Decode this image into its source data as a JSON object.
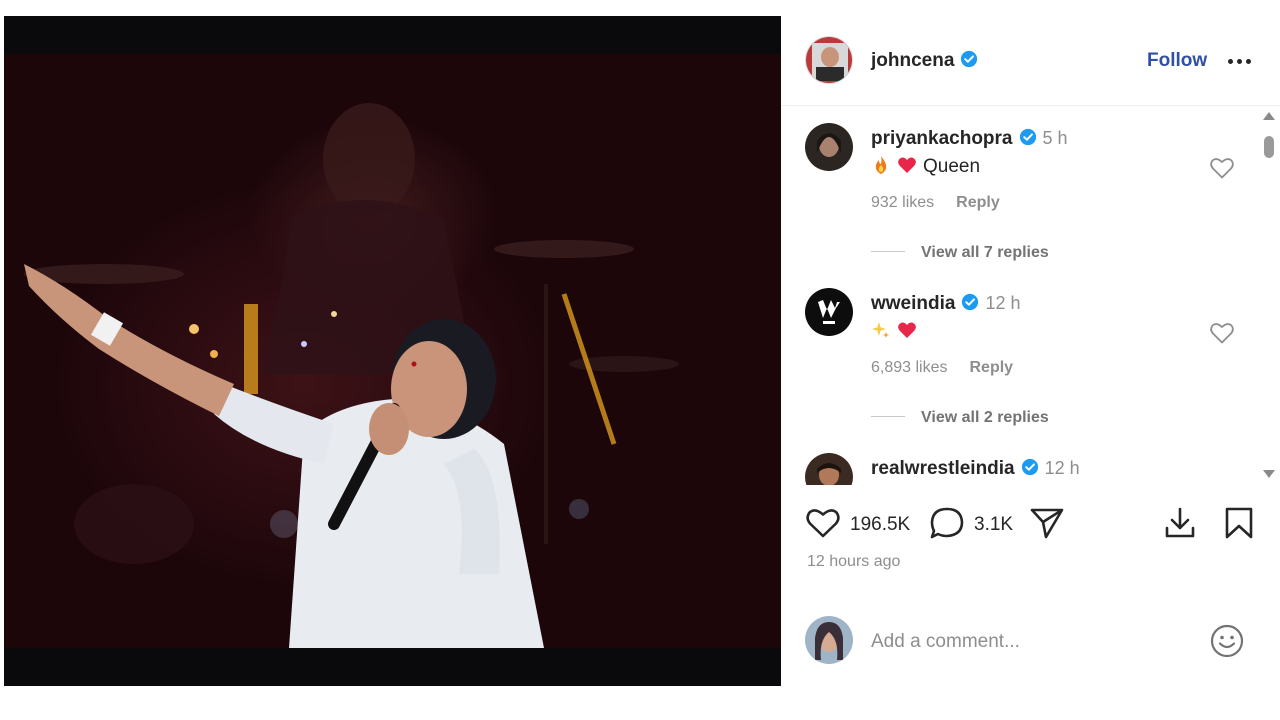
{
  "post": {
    "author": "johncena",
    "follow_label": "Follow",
    "likes_count": "196.5K",
    "comments_count": "3.1K",
    "time_ago": "12 hours ago"
  },
  "comments": [
    {
      "user": "priyankachopra",
      "time": "5 h",
      "text": "Queen",
      "emojis": [
        "fire",
        "red-heart"
      ],
      "likes": "932 likes",
      "reply_label": "Reply",
      "replies_label": "View all 7 replies"
    },
    {
      "user": "wweindia",
      "time": "12 h",
      "text": "",
      "emojis": [
        "sparkles",
        "red-heart"
      ],
      "likes": "6,893 likes",
      "reply_label": "Reply",
      "replies_label": "View all 2 replies"
    },
    {
      "user": "realwrestleindia",
      "time": "12 h"
    }
  ],
  "add_comment": {
    "placeholder": "Add a comment..."
  },
  "colors": {
    "verified": "#1d9bf0",
    "follow": "#2f4fa8",
    "heart": "#ed4956",
    "muted": "#8e8e8e"
  },
  "icons": [
    "verified-badge-icon",
    "more-options-icon",
    "heart-icon",
    "comment-icon",
    "share-icon",
    "download-icon",
    "bookmark-icon",
    "emoji-icon"
  ]
}
